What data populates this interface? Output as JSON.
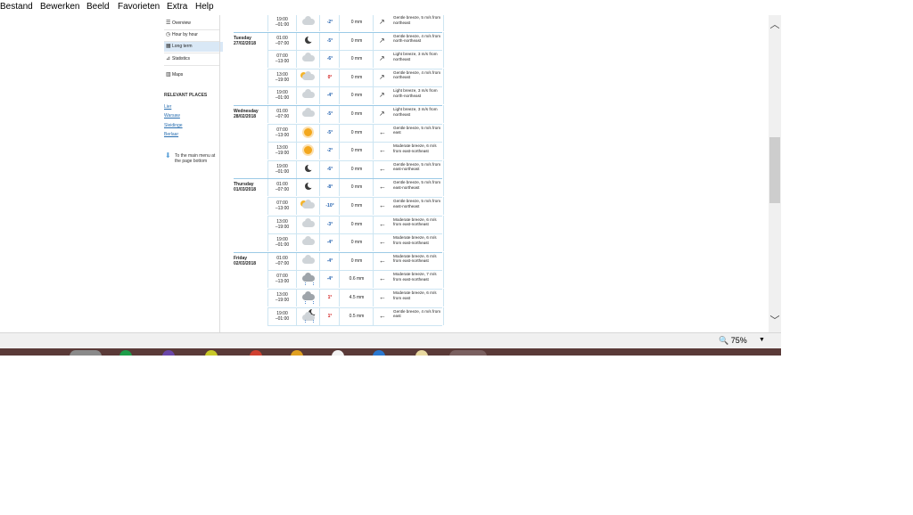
{
  "menubar": [
    "Bestand",
    "Bewerken",
    "Beeld",
    "Favorieten",
    "Extra",
    "Help"
  ],
  "nav": {
    "items": [
      {
        "icon": "list-icon",
        "glyph": "☰",
        "label": "Overview",
        "active": false
      },
      {
        "icon": "clock-icon",
        "glyph": "◷",
        "label": "Hour by hour",
        "active": false
      },
      {
        "icon": "calendar-icon",
        "glyph": "▦",
        "label": "Long term",
        "active": true
      },
      {
        "icon": "chart-icon",
        "glyph": "⊿",
        "label": "Statistics",
        "active": false
      },
      {
        "icon": "map-icon",
        "glyph": "▥",
        "label": "Maps",
        "active": false
      }
    ],
    "relevant_title": "RELEVANT PLACES",
    "places": [
      "Lier",
      "Warsaw",
      "Sleidinge",
      "Berlaar"
    ],
    "main_menu": "To the main menu at the page bottom"
  },
  "forecast": [
    {
      "day": "",
      "date": "",
      "time": [
        "19:00",
        "–01:00"
      ],
      "icon": "cloud",
      "temp": "-2°",
      "precip": "0 mm",
      "wind": "Gentle breeze, 5 m/s from northeast",
      "wind_dir": "↗"
    },
    {
      "day": "Tuesday",
      "date": "27/02/2018",
      "time": [
        "01:00",
        "–07:00"
      ],
      "icon": "moon",
      "temp": "-5°",
      "precip": "0 mm",
      "wind": "Gentle breeze, 4 m/s from north-northeast",
      "wind_dir": "↗"
    },
    {
      "day": "",
      "date": "",
      "time": [
        "07:00",
        "–13:00"
      ],
      "icon": "cloud",
      "temp": "-6°",
      "precip": "0 mm",
      "wind": "Light breeze, 3 m/s from northeast",
      "wind_dir": "↗"
    },
    {
      "day": "",
      "date": "",
      "time": [
        "13:00",
        "–19:00"
      ],
      "icon": "partly",
      "temp": "0°",
      "precip": "0 mm",
      "wind": "Gentle breeze, 4 m/s from northeast",
      "wind_dir": "↗"
    },
    {
      "day": "",
      "date": "",
      "time": [
        "19:00",
        "–01:00"
      ],
      "icon": "cloud",
      "temp": "-4°",
      "precip": "0 mm",
      "wind": "Light breeze, 3 m/s from north-northeast",
      "wind_dir": "↗"
    },
    {
      "day": "Wednesday",
      "date": "28/02/2018",
      "time": [
        "01:00",
        "–07:00"
      ],
      "icon": "cloud",
      "temp": "-5°",
      "precip": "0 mm",
      "wind": "Light breeze, 3 m/s from northeast",
      "wind_dir": "↗"
    },
    {
      "day": "",
      "date": "",
      "time": [
        "07:00",
        "–13:00"
      ],
      "icon": "sun",
      "temp": "-5°",
      "precip": "0 mm",
      "wind": "Gentle breeze, 5 m/s from east",
      "wind_dir": "←"
    },
    {
      "day": "",
      "date": "",
      "time": [
        "13:00",
        "–19:00"
      ],
      "icon": "sun",
      "temp": "-2°",
      "precip": "0 mm",
      "wind": "Moderate breeze, 6 m/s from east-northeast",
      "wind_dir": "←"
    },
    {
      "day": "",
      "date": "",
      "time": [
        "19:00",
        "–01:00"
      ],
      "icon": "moon",
      "temp": "-6°",
      "precip": "0 mm",
      "wind": "Gentle breeze, 5 m/s from east-northeast",
      "wind_dir": "←"
    },
    {
      "day": "Thursday",
      "date": "01/03/2018",
      "time": [
        "01:00",
        "–07:00"
      ],
      "icon": "moon",
      "temp": "-8°",
      "precip": "0 mm",
      "wind": "Gentle breeze, 5 m/s from east-northeast",
      "wind_dir": "←"
    },
    {
      "day": "",
      "date": "",
      "time": [
        "07:00",
        "–13:00"
      ],
      "icon": "partly",
      "temp": "-10°",
      "precip": "0 mm",
      "wind": "Gentle breeze, 5 m/s from east-northeast",
      "wind_dir": "←"
    },
    {
      "day": "",
      "date": "",
      "time": [
        "13:00",
        "–19:00"
      ],
      "icon": "cloud",
      "temp": "-3°",
      "precip": "0 mm",
      "wind": "Moderate breeze, 6 m/s from east-northeast",
      "wind_dir": "←"
    },
    {
      "day": "",
      "date": "",
      "time": [
        "19:00",
        "–01:00"
      ],
      "icon": "cloud",
      "temp": "-4°",
      "precip": "0 mm",
      "wind": "Moderate breeze, 6 m/s from east-northeast",
      "wind_dir": "←"
    },
    {
      "day": "Friday",
      "date": "02/03/2018",
      "time": [
        "01:00",
        "–07:00"
      ],
      "icon": "cloud",
      "temp": "-4°",
      "precip": "0 mm",
      "wind": "Moderate breeze, 6 m/s from east-northeast",
      "wind_dir": "←"
    },
    {
      "day": "",
      "date": "",
      "time": [
        "07:00",
        "–13:00"
      ],
      "icon": "snow",
      "temp": "-4°",
      "precip": "0.6 mm",
      "wind": "Moderate breeze, 7 m/s from east-northeast",
      "wind_dir": "←"
    },
    {
      "day": "",
      "date": "",
      "time": [
        "13:00",
        "–19:00"
      ],
      "icon": "rain",
      "temp": "1°",
      "precip": "4.5 mm",
      "wind": "Moderate breeze, 6 m/s from east",
      "wind_dir": "←"
    },
    {
      "day": "",
      "date": "",
      "time": [
        "19:00",
        "–01:00"
      ],
      "icon": "nightcloud",
      "temp": "1°",
      "precip": "0.5 mm",
      "wind": "Gentle breeze, 4 m/s from east",
      "wind_dir": "←"
    }
  ],
  "status": {
    "zoom": "75%"
  },
  "colors": {
    "accent": "#2a6fb0",
    "temp_neg": "#1f5fae",
    "temp_pos": "#d01818"
  }
}
